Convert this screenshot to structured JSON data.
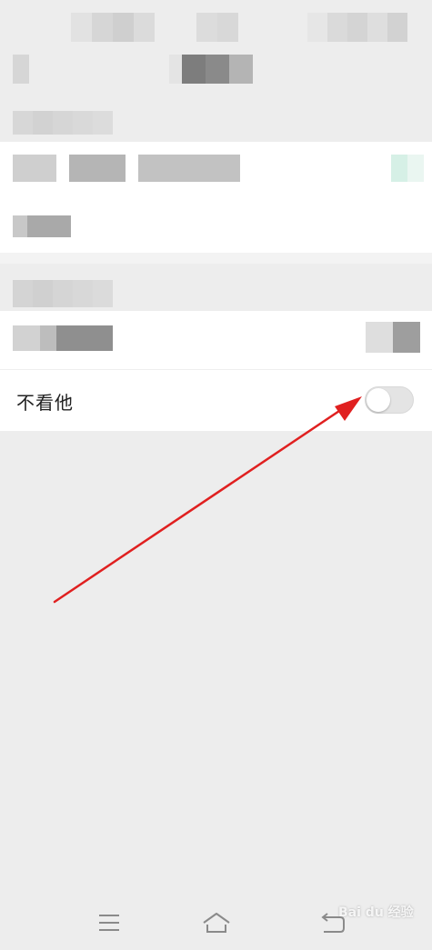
{
  "settings": {
    "hide_his_moments_label": "不看他",
    "hide_his_moments_enabled": false
  },
  "navbar": {
    "menu_icon": "menu-icon",
    "home_icon": "home-icon",
    "back_icon": "back-icon"
  },
  "watermark": {
    "text": "Bai du 经验"
  },
  "colors": {
    "background": "#ededed",
    "card": "#ffffff",
    "toggle_off": "#e4e4e4",
    "annotation_arrow": "#e02020"
  }
}
